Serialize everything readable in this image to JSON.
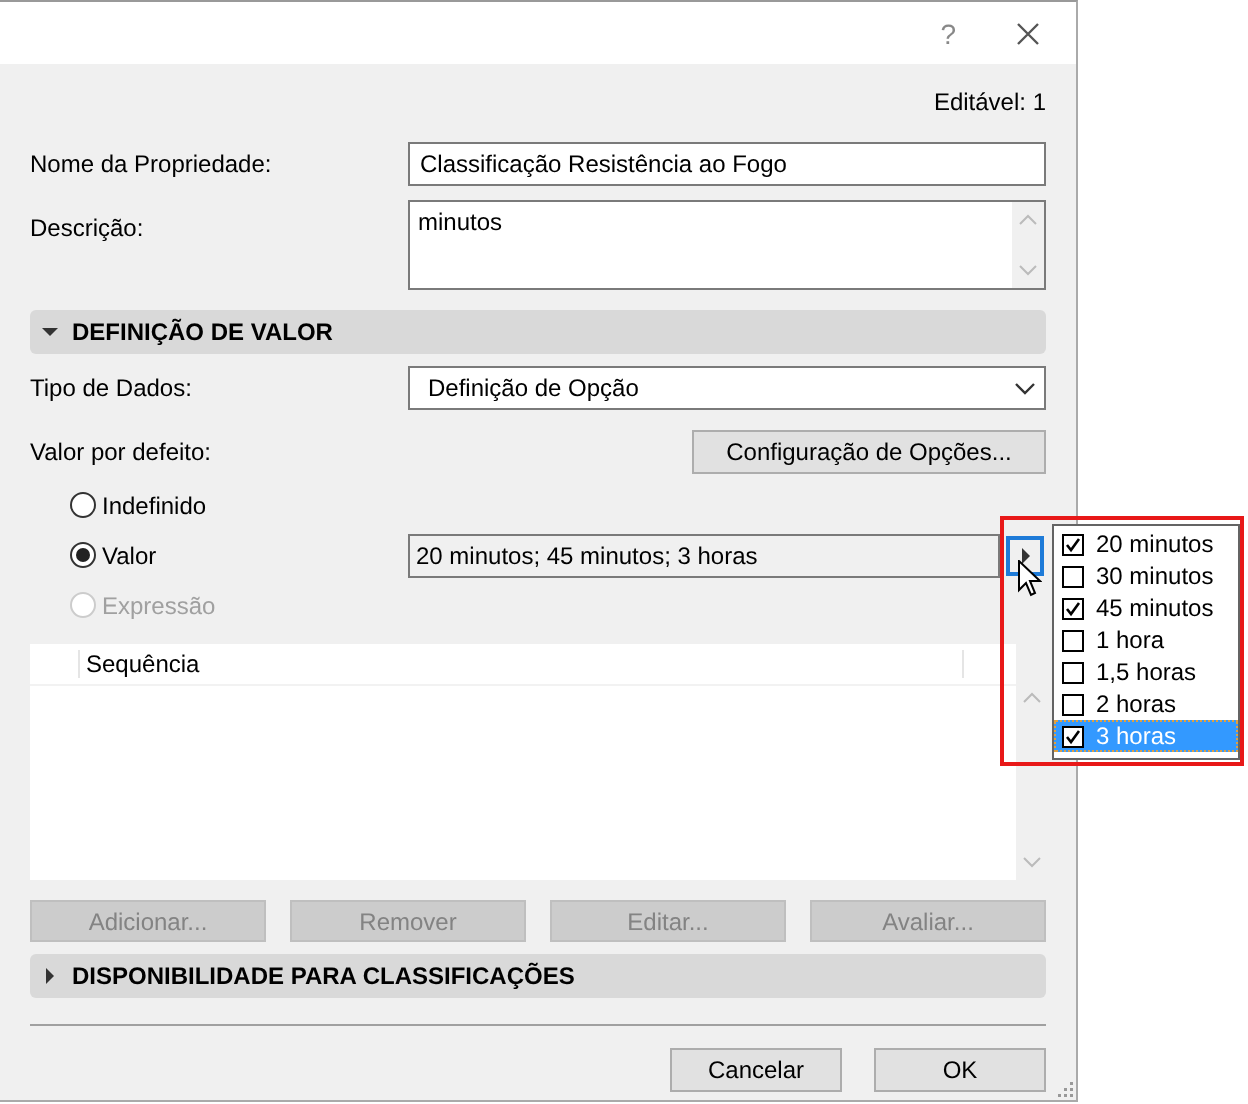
{
  "title_bar": {
    "help": "?"
  },
  "editable": "Editável: 1",
  "name_field": {
    "label": "Nome da Propriedade:",
    "value": "Classificação Resistência ao Fogo"
  },
  "description_field": {
    "label": "Descrição:",
    "value": "minutos"
  },
  "value_section": {
    "title": "DEFINIÇÃO DE VALOR",
    "expanded": true
  },
  "data_type": {
    "label": "Tipo de Dados:",
    "value": "Definição de Opção"
  },
  "default_value": {
    "label": "Valor por defeito:",
    "options_button": "Configuração de Opções..."
  },
  "radios": [
    {
      "label": "Indefinido",
      "selected": false,
      "disabled": false
    },
    {
      "label": "Valor",
      "selected": true,
      "disabled": false
    },
    {
      "label": "Expressão",
      "selected": false,
      "disabled": true
    }
  ],
  "value_field": "20 minutos; 45 minutos; 3 horas",
  "table": {
    "columns": [
      "Sequência"
    ]
  },
  "table_buttons": [
    {
      "label": "Adicionar...",
      "disabled": true
    },
    {
      "label": "Remover",
      "disabled": true
    },
    {
      "label": "Editar...",
      "disabled": true
    },
    {
      "label": "Avaliar...",
      "disabled": true
    }
  ],
  "classification_section": {
    "title": "DISPONIBILIDADE PARA CLASSIFICAÇÕES",
    "expanded": false
  },
  "buttons": [
    "Cancelar",
    "OK"
  ],
  "popup": {
    "items": [
      {
        "label": "20 minutos",
        "checked": true,
        "selected": false
      },
      {
        "label": "30 minutos",
        "checked": false,
        "selected": false
      },
      {
        "label": "45 minutos",
        "checked": true,
        "selected": false
      },
      {
        "label": "1 hora",
        "checked": false,
        "selected": false
      },
      {
        "label": "1,5 horas",
        "checked": false,
        "selected": false
      },
      {
        "label": "2 horas",
        "checked": false,
        "selected": false
      },
      {
        "label": "3 horas",
        "checked": true,
        "selected": true
      }
    ]
  }
}
